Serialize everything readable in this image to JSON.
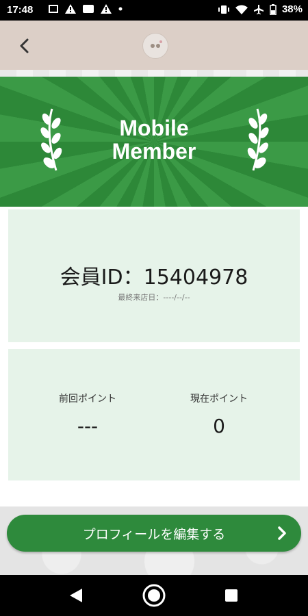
{
  "status_bar": {
    "time": "17:48",
    "battery_percent": "38%",
    "icons_left": [
      "sync-icon",
      "warning-icon",
      "image-icon",
      "warning-icon",
      "dot-icon"
    ],
    "icons_right": [
      "vibrate-icon",
      "wifi-icon",
      "airplane-icon",
      "battery-icon"
    ]
  },
  "header": {
    "back_icon": "chevron-left-icon",
    "logo": "store-logo"
  },
  "banner": {
    "title_line1": "Mobile",
    "title_line2": "Member",
    "accent": "#2f8a3a"
  },
  "member_card": {
    "member_id": "会員ID：15404978",
    "last_visit": "最終来店日：----/--/--"
  },
  "points_card": {
    "previous_label": "前回ポイント",
    "previous_value": "---",
    "current_label": "現在ポイント",
    "current_value": "0"
  },
  "cta": {
    "label": "プロフィールを編集する",
    "icon": "chevron-right-icon",
    "color": "#2e8a3c"
  },
  "nav_bar": {
    "back_icon": "nav-back-icon",
    "home_icon": "nav-home-icon",
    "recents_icon": "nav-recents-icon"
  }
}
